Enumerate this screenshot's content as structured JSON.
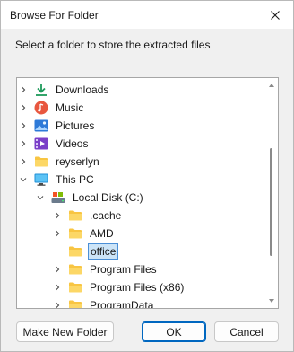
{
  "window": {
    "title": "Browse For Folder"
  },
  "prompt": "Select a folder to store the extracted files",
  "tree": [
    {
      "label": "Downloads",
      "icon": "download-icon",
      "chevron": "right",
      "level": 0
    },
    {
      "label": "Music",
      "icon": "music-icon",
      "chevron": "right",
      "level": 0
    },
    {
      "label": "Pictures",
      "icon": "pictures-icon",
      "chevron": "right",
      "level": 0
    },
    {
      "label": "Videos",
      "icon": "videos-icon",
      "chevron": "right",
      "level": 0
    },
    {
      "label": "reyserlyn",
      "icon": "folder-icon",
      "chevron": "right",
      "level": 0
    },
    {
      "label": "This PC",
      "icon": "pc-icon",
      "chevron": "down",
      "level": 0
    },
    {
      "label": "Local Disk (C:)",
      "icon": "drive-icon",
      "chevron": "down",
      "level": 1
    },
    {
      "label": ".cache",
      "icon": "folder-icon",
      "chevron": "right",
      "level": 2
    },
    {
      "label": "AMD",
      "icon": "folder-icon",
      "chevron": "right",
      "level": 2
    },
    {
      "label": "office",
      "icon": "folder-icon",
      "chevron": "none",
      "level": 2,
      "selected": true
    },
    {
      "label": "Program Files",
      "icon": "folder-icon",
      "chevron": "right",
      "level": 2
    },
    {
      "label": "Program Files (x86)",
      "icon": "folder-icon",
      "chevron": "right",
      "level": 2
    },
    {
      "label": "ProgramData",
      "icon": "folder-icon",
      "chevron": "right",
      "level": 2
    }
  ],
  "buttons": {
    "new_folder": "Make New Folder",
    "ok": "OK",
    "cancel": "Cancel"
  },
  "colors": {
    "accent": "#0067c0",
    "folder": "#f8c542",
    "selection": "#cce4f7"
  }
}
